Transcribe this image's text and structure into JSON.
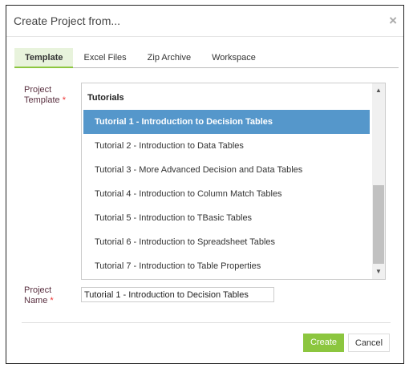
{
  "dialog": {
    "title": "Create Project from...",
    "close": "×"
  },
  "tabs": [
    "Template",
    "Excel Files",
    "Zip Archive",
    "Workspace"
  ],
  "form": {
    "template_label": "Project\nTemplate",
    "name_label": "Project\nName",
    "required": "*",
    "group": "Tutorials",
    "items": [
      "Tutorial 1 - Introduction to Decision Tables",
      "Tutorial 2 - Introduction to Data Tables",
      "Tutorial 3 - More Advanced Decision and Data Tables",
      "Tutorial 4 - Introduction to Column Match Tables",
      "Tutorial 5 - Introduction to TBasic Tables",
      "Tutorial 6 - Introduction to Spreadsheet Tables",
      "Tutorial 7 - Introduction to Table Properties"
    ],
    "name_value": "Tutorial 1 - Introduction to Decision Tables"
  },
  "buttons": {
    "create": "Create",
    "cancel": "Cancel"
  }
}
